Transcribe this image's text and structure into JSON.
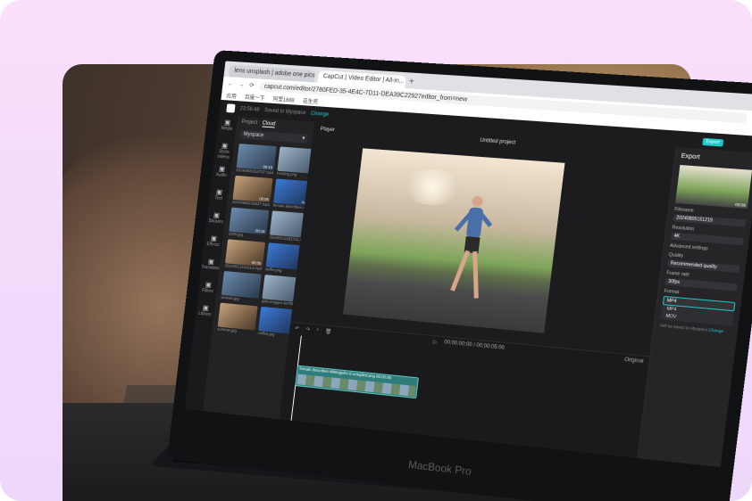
{
  "browser": {
    "tabs": [
      "lens unsplash | adobe one pics",
      "CapCut | Video Editor | All-in..."
    ],
    "new_tab": "+",
    "url": "capcut.com/editor/2780FED-35-4E4C-7D11-DEA39C22927editor_from=new",
    "bookmarks": [
      "应用",
      "百度一下",
      "阿里1688",
      "花生壳"
    ]
  },
  "app": {
    "breadcrumb": "23:56:48",
    "brand_small": "Saved to Myspace",
    "change_link": "Change",
    "nav": [
      {
        "icon": "media-icon",
        "label": "Media"
      },
      {
        "icon": "stock-icon",
        "label": "Stock videos"
      },
      {
        "icon": "audio-icon",
        "label": "Audio"
      },
      {
        "icon": "text-icon",
        "label": "Text"
      },
      {
        "icon": "stickers-icon",
        "label": "Stickers"
      },
      {
        "icon": "effects-icon",
        "label": "Effects"
      },
      {
        "icon": "transitions-icon",
        "label": "Transitions"
      },
      {
        "icon": "filters-icon",
        "label": "Filters"
      },
      {
        "icon": "library-icon",
        "label": "Library"
      }
    ],
    "media": {
      "tabs": [
        "Project",
        "Cloud"
      ],
      "space": "Myspace",
      "items": [
        {
          "label": "20240805154737.mp4",
          "dur": "00:15"
        },
        {
          "label": "running.png",
          "dur": ""
        },
        {
          "label": "20240806105837.mp4",
          "dur": "00:05"
        },
        {
          "label": "female describes-4l6t...",
          "dur": "Added"
        },
        {
          "label": "2005.jpg",
          "dur": "00:15"
        },
        {
          "label": "20240812162741.mp4",
          "dur": ""
        },
        {
          "label": "20240812154212.mp4",
          "dur": "00:05"
        },
        {
          "label": "selfie.png",
          "dur": ""
        },
        {
          "label": "woman.jpg",
          "dur": ""
        },
        {
          "label": "girls-images-4e7f8s.png",
          "dur": ""
        },
        {
          "label": "summer.jpg",
          "dur": ""
        },
        {
          "label": "coffee.jpg",
          "dur": ""
        }
      ]
    },
    "player": {
      "label": "Player",
      "title": "Untitled project",
      "ratio": "Original"
    },
    "timeline": {
      "timecode": "00:00:00:00 / 00:00:05:00",
      "clip_label": "female describes-4l6tregwhc-5-untupled.png   00:00:05"
    },
    "export": {
      "button": "Export",
      "title": "Export",
      "thumb_dur": "00:05",
      "filename_label": "Filename",
      "filename": "20240805151219",
      "resolution_label": "Resolution",
      "resolution": "4K",
      "advanced": "Advanced settings",
      "quality_label": "Quality",
      "quality": "Recommended quality",
      "framerate_label": "Frame rate",
      "framerate": "30fps",
      "format_label": "Format",
      "format": "MP4",
      "format_options": [
        "MP4",
        "MOV"
      ],
      "note": "Will be saved to Myspace",
      "note_link": "Change"
    }
  },
  "laptop_brand": "MacBook Pro"
}
